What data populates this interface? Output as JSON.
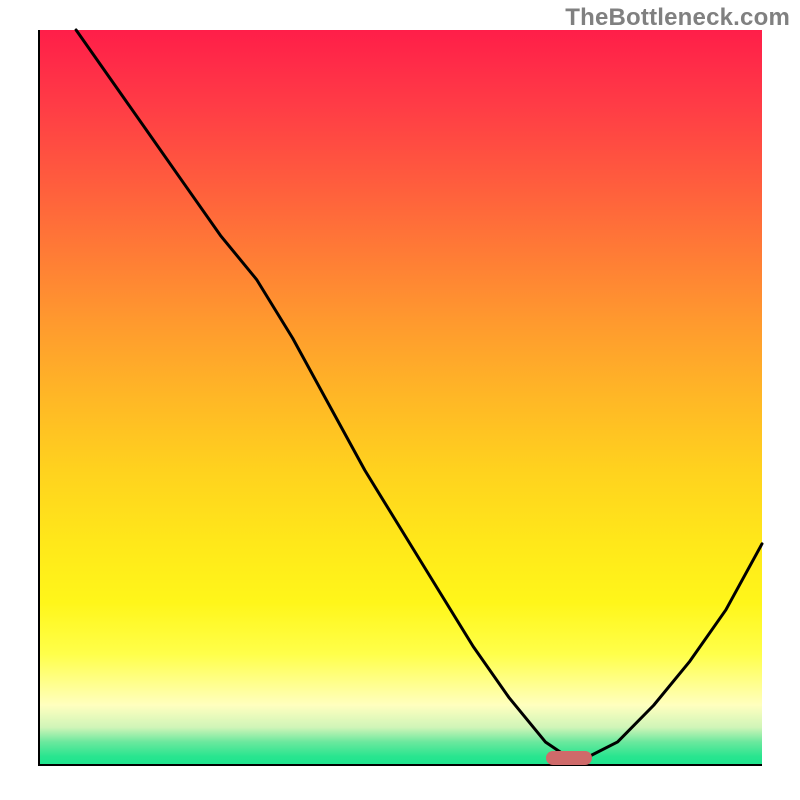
{
  "watermark": "TheBottleneck.com",
  "chart_data": {
    "type": "line",
    "title": "",
    "xlabel": "",
    "ylabel": "",
    "xlim": [
      0,
      100
    ],
    "ylim": [
      0,
      100
    ],
    "grid": false,
    "legend": false,
    "description": "Bottleneck curve over a red-to-green vertical gradient. Y is a bottleneck-severity metric (lower is better, green zone). Minimum at the marker around x≈73.",
    "series": [
      {
        "name": "bottleneck-curve",
        "x": [
          5,
          10,
          15,
          20,
          25,
          30,
          35,
          40,
          45,
          50,
          55,
          60,
          65,
          70,
          73,
          76,
          80,
          85,
          90,
          95,
          100
        ],
        "y": [
          100,
          93,
          86,
          79,
          72,
          66,
          58,
          49,
          40,
          32,
          24,
          16,
          9,
          3,
          1,
          1,
          3,
          8,
          14,
          21,
          30
        ]
      }
    ],
    "marker": {
      "x": 73,
      "y": 1,
      "color": "#cf6a6a",
      "shape": "pill"
    },
    "gradient_stops": [
      {
        "pos": 0,
        "color": "#ff1e49"
      },
      {
        "pos": 50,
        "color": "#ffb726"
      },
      {
        "pos": 85,
        "color": "#ffff4a"
      },
      {
        "pos": 100,
        "color": "#1fe48e"
      }
    ]
  }
}
